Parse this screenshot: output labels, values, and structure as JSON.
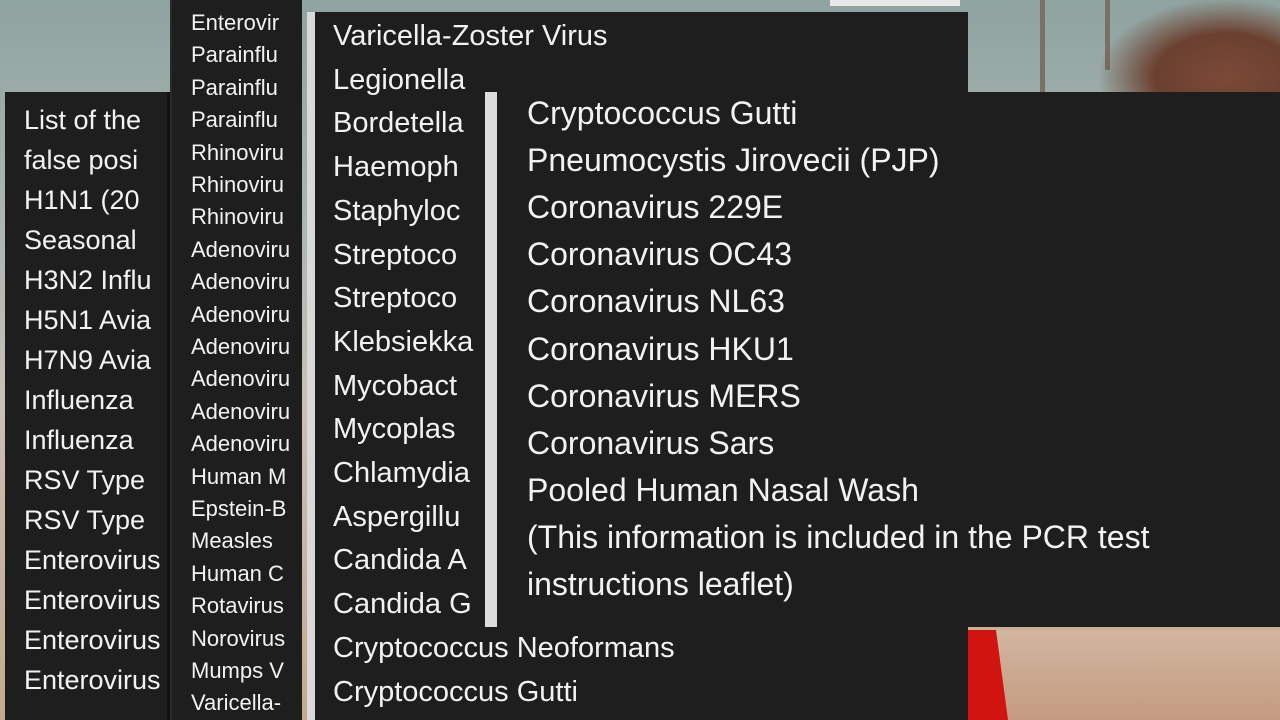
{
  "panel_left_lines": [
    "List of the",
    "false posi",
    "H1N1 (20",
    "Seasonal",
    "H3N2 Influ",
    "H5N1 Avia",
    "H7N9 Avia",
    "Influenza",
    "Influenza",
    "RSV Type",
    "RSV Type",
    "Enterovirus",
    "Enterovirus",
    "Enterovirus",
    "Enterovirus"
  ],
  "panel_second_lines": [
    "Enterovir",
    "Parainflu",
    "Parainflu",
    "Parainflu",
    "Rhinoviru",
    "Rhinoviru",
    "Rhinoviru",
    "Adenoviru",
    "Adenoviru",
    "Adenoviru",
    "Adenoviru",
    "Adenoviru",
    "Adenoviru",
    "Adenoviru",
    "Human M",
    "Epstein-B",
    "Measles",
    "Human C",
    "Rotavirus",
    "Norovirus",
    "Mumps V",
    "Varicella-"
  ],
  "panel_third_lines": [
    "Varicella-Zoster Virus",
    "Legionella",
    "Bordetella",
    "Haemoph",
    "Staphyloc",
    "Streptoco",
    "Streptoco",
    "Klebsiekka",
    "Mycobact",
    "Mycoplas",
    "Chlamydia",
    "Aspergillu",
    "Candida A",
    "Candida G",
    "Cryptococcus Neoformans",
    "Cryptococcus Gutti"
  ],
  "panel_front_lines": [
    "Cryptococcus Gutti",
    "Pneumocystis Jirovecii (PJP)",
    "Coronavirus 229E",
    "Coronavirus OC43",
    "Coronavirus NL63",
    "Coronavirus HKU1",
    "Coronavirus MERS",
    "Coronavirus Sars",
    "Pooled Human Nasal Wash",
    "(This information is included in the PCR test",
    "instructions leaflet)"
  ]
}
